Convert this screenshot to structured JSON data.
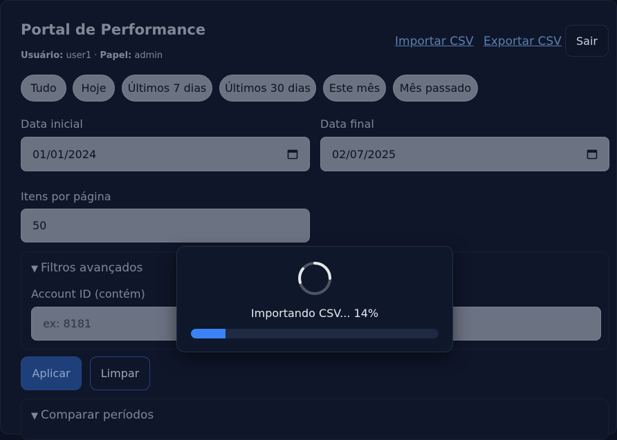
{
  "header": {
    "title": "Portal de Performance",
    "user_label": "Usuário:",
    "user_value": "user1",
    "separator": "·",
    "role_label": "Papel:",
    "role_value": "admin",
    "import_link": "Importar CSV",
    "export_link": "Exportar CSV",
    "exit_button": "Sair"
  },
  "quick_filters": [
    "Tudo",
    "Hoje",
    "Últimos 7 dias",
    "Últimos 30 dias",
    "Este mês",
    "Mês passado"
  ],
  "dates": {
    "start_label": "Data inicial",
    "start_value": "01/01/2024",
    "end_label": "Data final",
    "end_value": "02/07/2025"
  },
  "per_page": {
    "label": "Itens por página",
    "value": "50"
  },
  "advanced": {
    "summary": "Filtros avançados",
    "account_label": "Account ID (contém)",
    "account_placeholder": "ex: 8181"
  },
  "actions": {
    "apply": "Aplicar",
    "clear": "Limpar"
  },
  "compare": {
    "summary": "Comparar períodos"
  },
  "import_modal": {
    "text": "Importando CSV... 14%",
    "progress": 0.14
  },
  "colors": {
    "accent": "#3b82f6",
    "background": "#0b1120"
  },
  "icons": {
    "calendar": "calendar-icon",
    "spinner": "loading-spinner-icon",
    "disclosure": "triangle-down-icon"
  }
}
